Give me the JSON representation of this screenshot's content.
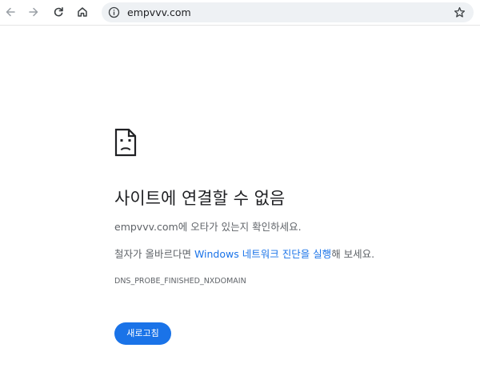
{
  "browser": {
    "url": "empvvv.com",
    "icons": {
      "back": "back-arrow-icon",
      "forward": "forward-arrow-icon",
      "reload": "reload-icon",
      "home": "home-icon",
      "site_info": "site-info-icon",
      "bookmark": "bookmark-star-icon"
    }
  },
  "error_page": {
    "icon": "sad-page-icon",
    "title": "사이트에 연결할 수 없음",
    "typo_domain": "empvvv.com",
    "typo_suffix": "에 오타가 있는지 확인하세요.",
    "check_prefix": "철자가 올바르다면 ",
    "diagnostics_link": "Windows 네트워크 진단을 실행",
    "check_suffix": "해 보세요.",
    "error_code": "DNS_PROBE_FINISHED_NXDOMAIN",
    "reload_label": "새로고침"
  },
  "colors": {
    "accent": "#1a73e8",
    "text_primary": "#202124",
    "text_secondary": "#5f6368",
    "omnibox_bg": "#eef1f4"
  }
}
